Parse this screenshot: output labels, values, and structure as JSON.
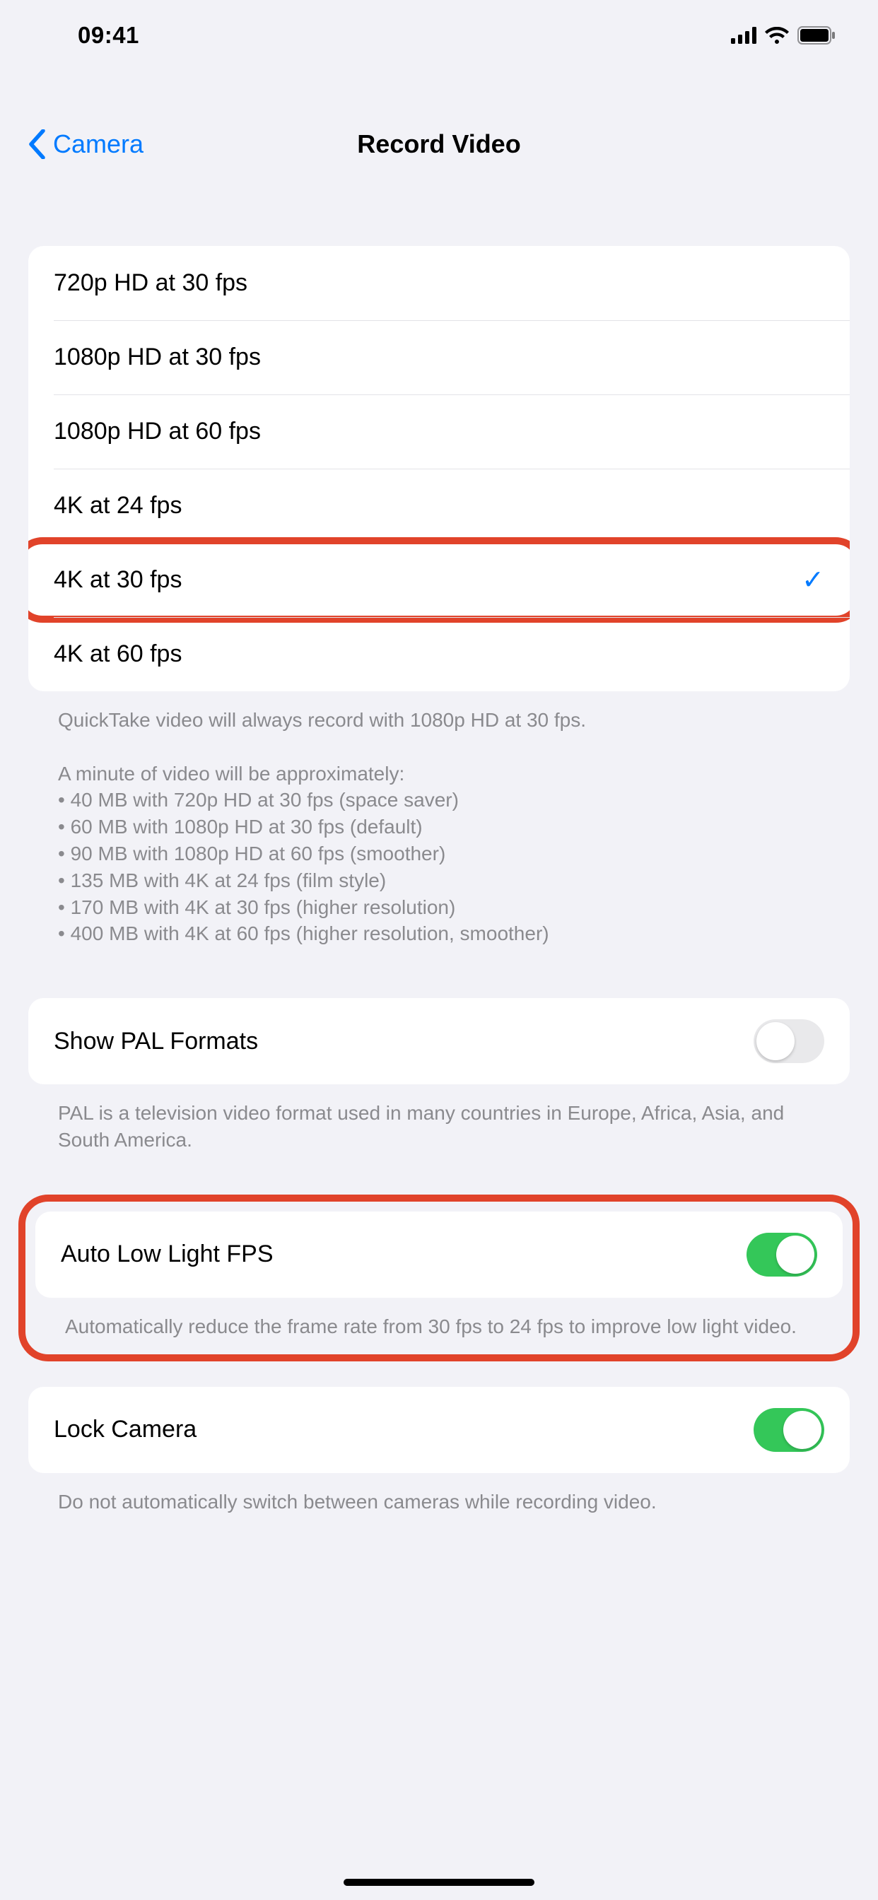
{
  "status": {
    "time": "09:41"
  },
  "nav": {
    "back": "Camera",
    "title": "Record Video"
  },
  "resolutions": [
    {
      "label": "720p HD at 30 fps",
      "selected": false
    },
    {
      "label": "1080p HD at 30 fps",
      "selected": false
    },
    {
      "label": "1080p HD at 60 fps",
      "selected": false
    },
    {
      "label": "4K at 24 fps",
      "selected": false
    },
    {
      "label": "4K at 30 fps",
      "selected": true
    },
    {
      "label": "4K at 60 fps",
      "selected": false
    }
  ],
  "resolution_footer": {
    "quicktake": "QuickTake video will always record with 1080p HD at 30 fps.",
    "intro": "A minute of video will be approximately:",
    "lines": [
      "• 40 MB with 720p HD at 30 fps (space saver)",
      "• 60 MB with 1080p HD at 30 fps (default)",
      "• 90 MB with 1080p HD at 60 fps (smoother)",
      "• 135 MB with 4K at 24 fps (film style)",
      "• 170 MB with 4K at 30 fps (higher resolution)",
      "• 400 MB with 4K at 60 fps (higher resolution, smoother)"
    ]
  },
  "pal": {
    "label": "Show PAL Formats",
    "enabled": false,
    "footer": "PAL is a television video format used in many countries in Europe, Africa, Asia, and South America."
  },
  "lowlight": {
    "label": "Auto Low Light FPS",
    "enabled": true,
    "footer": "Automatically reduce the frame rate from 30 fps to 24 fps to improve low light video."
  },
  "lockcamera": {
    "label": "Lock Camera",
    "enabled": true,
    "footer": "Do not automatically switch between cameras while recording video."
  }
}
